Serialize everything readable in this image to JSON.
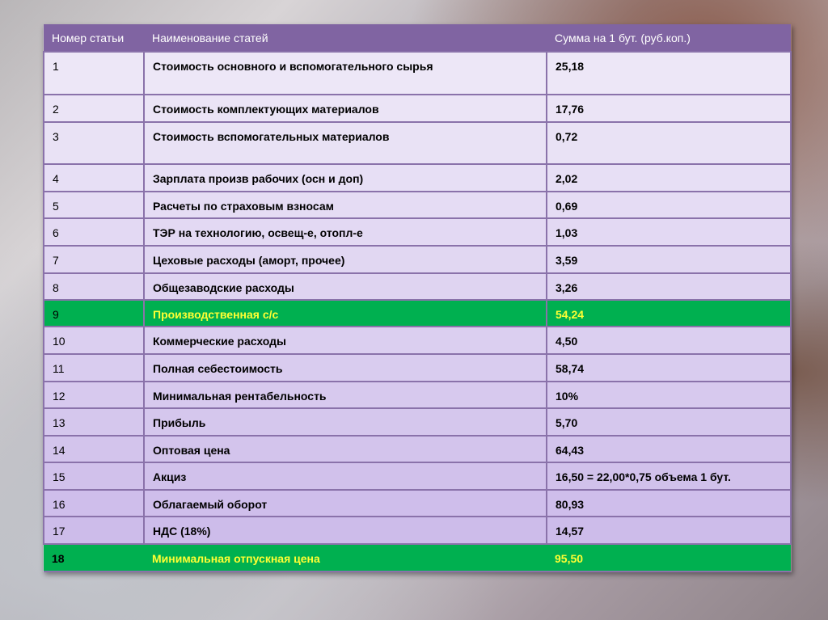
{
  "table": {
    "headers": [
      "Номер статьи",
      "Наименование статей",
      "Сумма на 1 бут. (руб.коп.)"
    ],
    "rows": [
      {
        "num": "1",
        "name": "Стоимость основного и вспомогательного сырья",
        "value": "25,18"
      },
      {
        "num": "2",
        "name": "Стоимость комплектующих материалов",
        "value": "17,76"
      },
      {
        "num": "3",
        "name": "Стоимость вспомогательных материалов",
        "value": "0,72"
      },
      {
        "num": "4",
        "name": "Зарплата произв рабочих (осн и доп)",
        "value": "2,02"
      },
      {
        "num": "5",
        "name": "Расчеты по страховым взносам",
        "value": "0,69"
      },
      {
        "num": "6",
        "name": "ТЭР на технологию, освещ-е, отопл-е",
        "value": "1,03"
      },
      {
        "num": "7",
        "name": "Цеховые расходы (аморт, прочее)",
        "value": "3,59"
      },
      {
        "num": "8",
        "name": "Общезаводские расходы",
        "value": "3,26"
      },
      {
        "num": "9",
        "name": "Производственная с/с",
        "value": "54,24"
      },
      {
        "num": "10",
        "name": "Коммерческие расходы",
        "value": "4,50"
      },
      {
        "num": "11",
        "name": "Полная себестоимость",
        "value": "58,74"
      },
      {
        "num": "12",
        "name": "Минимальная рентабельность",
        "value": "10%"
      },
      {
        "num": "13",
        "name": "Прибыль",
        "value": "5,70"
      },
      {
        "num": "14",
        "name": "Оптовая цена",
        "value": "64,43"
      },
      {
        "num": "15",
        "name": "Акциз",
        "value": "16,50 = 22,00*0,75 объема 1 бут."
      },
      {
        "num": "16",
        "name": "Облагаемый оборот",
        "value": "80,93"
      },
      {
        "num": "17",
        "name": "НДС (18%)",
        "value": "14,57"
      },
      {
        "num": "18",
        "name": "Минимальная отпускная цена",
        "value": "95,50"
      }
    ]
  },
  "colors": {
    "header": "#8064a2",
    "highlight": "#00b050",
    "highlight_text": "#ffff33"
  }
}
